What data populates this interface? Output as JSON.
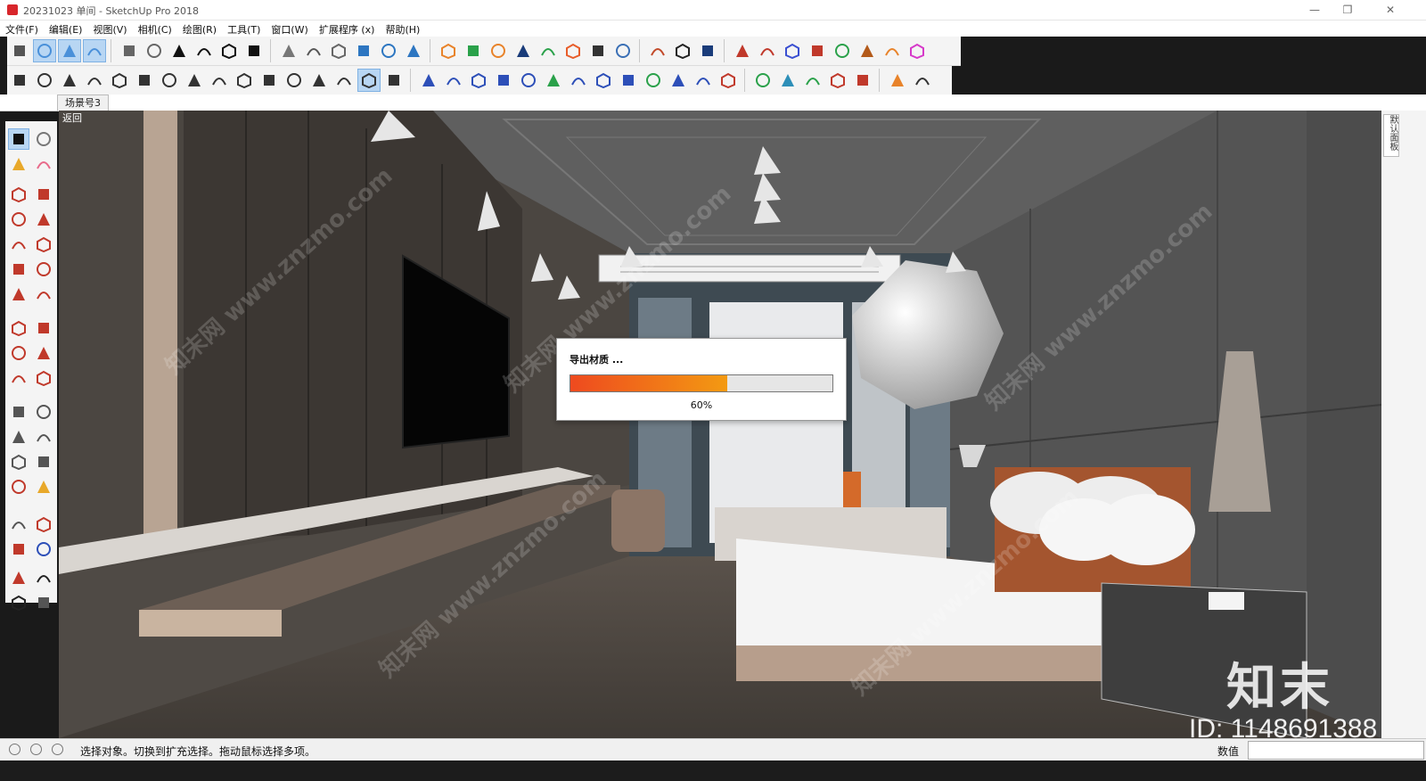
{
  "window": {
    "title": "20231023 单间 - SketchUp Pro 2018",
    "minimize_glyph": "—",
    "restore_glyph": "❐",
    "close_glyph": "✕"
  },
  "menu": [
    "文件(F)",
    "编辑(E)",
    "视图(V)",
    "相机(C)",
    "绘图(R)",
    "工具(T)",
    "窗口(W)",
    "扩展程序 (x)",
    "帮助(H)"
  ],
  "toolbar_row1": [
    {
      "name": "orbit-target-icon",
      "color": "#555555"
    },
    {
      "name": "xray-view-icon",
      "color": "#4a90d9",
      "active": true
    },
    {
      "name": "back-edges-icon",
      "color": "#4a90d9",
      "active": true
    },
    {
      "name": "wireframe-cube-icon",
      "color": "#4a90d9",
      "active": true
    },
    {
      "sep": true
    },
    {
      "name": "iso-view-icon",
      "color": "#666666"
    },
    {
      "name": "top-view-icon",
      "color": "#666666"
    },
    {
      "name": "front-view-icon",
      "color": "#111111"
    },
    {
      "name": "right-view-icon",
      "color": "#111111"
    },
    {
      "name": "back-view-icon",
      "color": "#111111"
    },
    {
      "name": "left-view-icon",
      "color": "#111111"
    },
    {
      "sep": true
    },
    {
      "name": "xray-mode-icon",
      "color": "#777777"
    },
    {
      "name": "wireframe-mode-icon",
      "color": "#555555"
    },
    {
      "name": "hidden-line-icon",
      "color": "#666666"
    },
    {
      "name": "shaded-icon",
      "color": "#2d76c1"
    },
    {
      "name": "shaded-texture-icon",
      "color": "#2d76c1"
    },
    {
      "name": "monochrome-icon",
      "color": "#2d76c1"
    },
    {
      "sep": true
    },
    {
      "name": "extension-warehouse-icon",
      "color": "#e8832a"
    },
    {
      "name": "refresh-sync-icon",
      "color": "#2aa14a"
    },
    {
      "name": "send-to-layout-icon",
      "color": "#e8832a"
    },
    {
      "name": "add-location-icon",
      "color": "#1a3c7a"
    },
    {
      "name": "3d-warehouse-icon",
      "color": "#2aa14a"
    },
    {
      "name": "photo-textures-icon",
      "color": "#e85d2a"
    },
    {
      "name": "checker-pattern-icon",
      "color": "#333333"
    },
    {
      "name": "cloud-upload-icon",
      "color": "#3a6fb5"
    },
    {
      "sep": true
    },
    {
      "name": "settings-gear-icon",
      "color": "#c24a2a"
    },
    {
      "name": "mail-icon",
      "color": "#222222"
    },
    {
      "name": "info-icon",
      "color": "#1a3c7a"
    },
    {
      "sep": true
    },
    {
      "name": "sandbox-up-icon",
      "color": "#c0392b"
    },
    {
      "name": "sandbox-equal-icon",
      "color": "#c0392b"
    },
    {
      "name": "sandbox-j-icon",
      "color": "#3a4fd1"
    },
    {
      "name": "sandbox-r-icon",
      "color": "#c0392b"
    },
    {
      "name": "sandbox-v-icon",
      "color": "#2aa14a"
    },
    {
      "name": "sandbox-n-icon",
      "color": "#b35a1a"
    },
    {
      "name": "sandbox-x-icon",
      "color": "#e8832a"
    },
    {
      "name": "sandbox-f-icon",
      "color": "#d63ac9"
    }
  ],
  "toolbar_row2": [
    {
      "name": "shape-trapezoid-icon",
      "color": "#333333"
    },
    {
      "name": "shape-quad-icon",
      "color": "#333333"
    },
    {
      "name": "shape-rhombus-icon",
      "color": "#333333"
    },
    {
      "name": "shape-triangle-icon",
      "color": "#333333"
    },
    {
      "name": "shape-box-icon",
      "color": "#333333"
    },
    {
      "name": "shape-circle-icon",
      "color": "#333333"
    },
    {
      "name": "shape-cup-icon",
      "color": "#333333"
    },
    {
      "name": "shape-drop-icon",
      "color": "#333333"
    },
    {
      "name": "shape-dome-icon",
      "color": "#333333"
    },
    {
      "name": "shape-lens-icon",
      "color": "#333333"
    },
    {
      "name": "shape-ellipse-icon",
      "color": "#333333"
    },
    {
      "name": "shape-pentagon-icon",
      "color": "#333333"
    },
    {
      "name": "shape-sphere-icon",
      "color": "#333333"
    },
    {
      "name": "shape-geodesic-icon",
      "color": "#333333"
    },
    {
      "name": "shape-gem-icon",
      "color": "#333333",
      "active": true
    },
    {
      "name": "shape-u-icon",
      "color": "#333333"
    },
    {
      "sep": true
    },
    {
      "name": "curve-arch-icon",
      "color": "#2d4fb8"
    },
    {
      "name": "curve-wave-icon",
      "color": "#2d4fb8"
    },
    {
      "name": "curve-zigzag-icon",
      "color": "#2d4fb8"
    },
    {
      "name": "curve-s-icon",
      "color": "#2d4fb8"
    },
    {
      "name": "curve-cross-icon",
      "color": "#2d4fb8"
    },
    {
      "name": "curve-arc-green-icon",
      "color": "#2aa14a"
    },
    {
      "name": "curve-rect-icon",
      "color": "#2d4fb8"
    },
    {
      "name": "curve-spiral-icon",
      "color": "#2d4fb8"
    },
    {
      "name": "curve-hook-icon",
      "color": "#2d4fb8"
    },
    {
      "name": "curve-zig-green-icon",
      "color": "#2aa14a"
    },
    {
      "name": "curve-bend-icon",
      "color": "#2d4fb8"
    },
    {
      "name": "curve-hump-icon",
      "color": "#2d4fb8"
    },
    {
      "name": "curve-arc-red-icon",
      "color": "#c0392b"
    },
    {
      "sep": true
    },
    {
      "name": "polyline-icon",
      "color": "#2aa14a"
    },
    {
      "name": "polygon-icon",
      "color": "#2d8fb8"
    },
    {
      "name": "wrench-icon",
      "color": "#2aa14a"
    },
    {
      "name": "circle-red-icon",
      "color": "#c0392b"
    },
    {
      "name": "triangle-red-icon",
      "color": "#c0392b"
    },
    {
      "sep": true
    },
    {
      "name": "color-palette-icon",
      "color": "#e8832a"
    },
    {
      "name": "cursor-pick-icon",
      "color": "#333333"
    }
  ],
  "scene_tab": "场景号3",
  "viewport": {
    "back_label": "返回"
  },
  "left_tools": [
    {
      "name": "select-arrow-icon",
      "color": "#111111",
      "active": true
    },
    {
      "name": "component-icon",
      "color": "#777777"
    },
    {
      "name": "paint-bucket-icon",
      "color": "#e8a82a"
    },
    {
      "name": "eraser-icon",
      "color": "#e86a8a"
    },
    {
      "name": "pencil-line-icon",
      "color": "#c0392b"
    },
    {
      "name": "freehand-icon",
      "color": "#c0392b"
    },
    {
      "name": "rectangle-icon",
      "color": "#c0392b"
    },
    {
      "name": "rotated-rect-icon",
      "color": "#c0392b"
    },
    {
      "name": "circle-tool-icon",
      "color": "#c0392b"
    },
    {
      "name": "polygon-tool-icon",
      "color": "#c0392b"
    },
    {
      "name": "arc-icon",
      "color": "#c0392b"
    },
    {
      "name": "arc-2pt-icon",
      "color": "#c0392b"
    },
    {
      "name": "arc-3pt-icon",
      "color": "#c0392b"
    },
    {
      "name": "pie-icon",
      "color": "#c0392b"
    },
    {
      "name": "move-icon",
      "color": "#c0392b"
    },
    {
      "name": "push-pull-icon",
      "color": "#c0392b"
    },
    {
      "name": "rotate-icon",
      "color": "#c0392b"
    },
    {
      "name": "follow-me-icon",
      "color": "#c0392b"
    },
    {
      "name": "scale-icon",
      "color": "#c0392b"
    },
    {
      "name": "offset-icon",
      "color": "#c0392b"
    },
    {
      "name": "tape-measure-icon",
      "color": "#555555"
    },
    {
      "name": "dimension-icon",
      "color": "#555555"
    },
    {
      "name": "protractor-icon",
      "color": "#555555"
    },
    {
      "name": "text-tool-icon",
      "color": "#555555"
    },
    {
      "name": "axes-icon",
      "color": "#555555"
    },
    {
      "name": "3d-text-icon",
      "color": "#555555"
    },
    {
      "name": "orbit-icon",
      "color": "#c0392b"
    },
    {
      "name": "pan-hand-icon",
      "color": "#e8a82a"
    },
    {
      "name": "zoom-icon",
      "color": "#555555"
    },
    {
      "name": "zoom-window-icon",
      "color": "#c0392b"
    },
    {
      "name": "zoom-extents-icon",
      "color": "#c0392b"
    },
    {
      "name": "previous-view-icon",
      "color": "#2d4fb8"
    },
    {
      "name": "position-camera-icon",
      "color": "#c0392b"
    },
    {
      "name": "look-around-icon",
      "color": "#222222"
    },
    {
      "name": "walk-icon",
      "color": "#222222"
    },
    {
      "name": "section-plane-icon",
      "color": "#555555"
    }
  ],
  "right_panel": {
    "tab_label": "默认面板"
  },
  "dialog": {
    "title": "导出材质 ...",
    "progress": 0.6,
    "percent_text": "60%"
  },
  "status": {
    "message": "选择对象。切换到扩充选择。拖动鼠标选择多项。",
    "value_label": "数值",
    "value": ""
  },
  "watermark": {
    "brand": "知末",
    "id_text": "ID: 1148691388",
    "site": "知末网 www.znzmo.com"
  }
}
